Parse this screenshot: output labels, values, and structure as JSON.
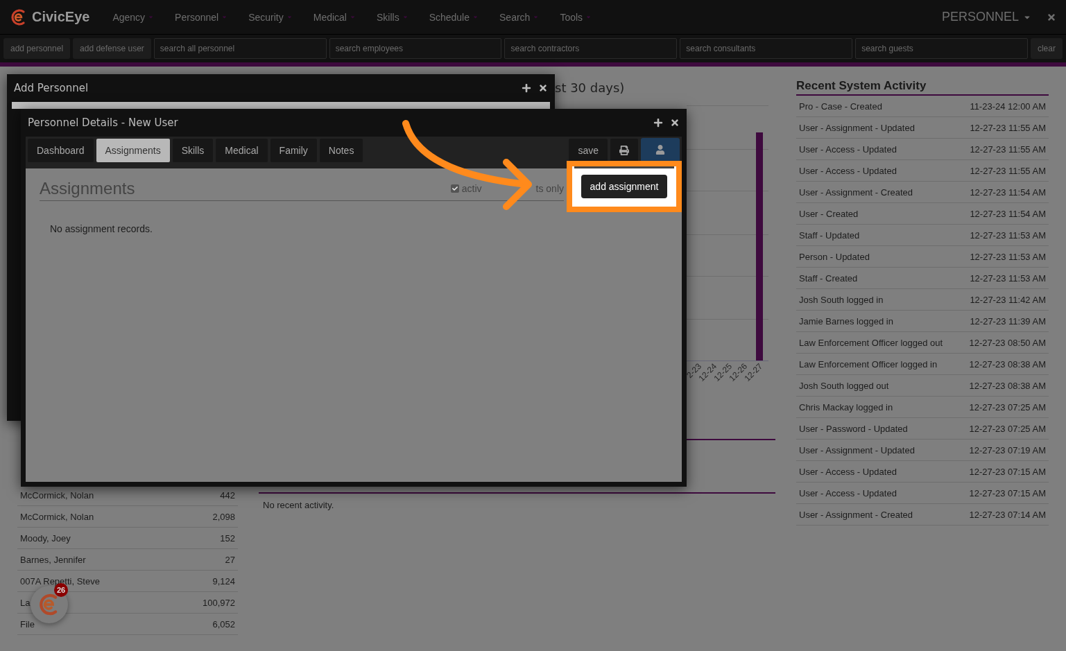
{
  "app": {
    "logo_text": "CivicEye",
    "menu": [
      {
        "label": "Agency"
      },
      {
        "label": "Personnel"
      },
      {
        "label": "Security"
      },
      {
        "label": "Medical"
      },
      {
        "label": "Skills"
      },
      {
        "label": "Schedule"
      },
      {
        "label": "Search"
      },
      {
        "label": "Tools"
      }
    ],
    "section": "PERSONNEL"
  },
  "toolbar": {
    "buttons": [
      "add personnel",
      "add defense user"
    ],
    "searches": [
      {
        "placeholder": "search all personnel"
      },
      {
        "placeholder": "search employees"
      },
      {
        "placeholder": "search contractors"
      },
      {
        "placeholder": "search consultants"
      },
      {
        "placeholder": "search guests"
      }
    ],
    "clear": "clear"
  },
  "background": {
    "chart_title": "st 30 days)",
    "x_labels": [
      "2-23",
      "12-24",
      "12-25",
      "12-26",
      "12-27"
    ],
    "activity_note": "No recent activity.",
    "people": [
      {
        "name": "McCormick, Nolan",
        "count": "442"
      },
      {
        "name": "McCormick, Nolan",
        "count": "2,098"
      },
      {
        "name": "Moody, Joey",
        "count": "152"
      },
      {
        "name": "Barnes, Jennifer",
        "count": "27"
      },
      {
        "name": "007A Repetti, Steve",
        "count": "9,124"
      },
      {
        "name": "La",
        "count": "100,972"
      },
      {
        "name": "File",
        "count": "6,052"
      }
    ],
    "recent": {
      "title": "Recent System Activity",
      "items": [
        {
          "event": "Pro - Case - Created",
          "time": "11-23-24 12:00 AM"
        },
        {
          "event": "User - Assignment - Updated",
          "time": "12-27-23 11:55 AM"
        },
        {
          "event": "User - Access - Updated",
          "time": "12-27-23 11:55 AM"
        },
        {
          "event": "User - Access - Updated",
          "time": "12-27-23 11:55 AM"
        },
        {
          "event": "User - Assignment - Created",
          "time": "12-27-23 11:54 AM"
        },
        {
          "event": "User - Created",
          "time": "12-27-23 11:54 AM"
        },
        {
          "event": "Staff - Updated",
          "time": "12-27-23 11:53 AM"
        },
        {
          "event": "Person - Updated",
          "time": "12-27-23 11:53 AM"
        },
        {
          "event": "Staff - Created",
          "time": "12-27-23 11:53 AM"
        },
        {
          "event": "Josh South logged in",
          "time": "12-27-23 11:42 AM"
        },
        {
          "event": "Jamie Barnes logged in",
          "time": "12-27-23 11:39 AM"
        },
        {
          "event": "Law Enforcement Officer logged out",
          "time": "12-27-23 08:50 AM"
        },
        {
          "event": "Law Enforcement Officer logged in",
          "time": "12-27-23 08:38 AM"
        },
        {
          "event": "Josh South logged out",
          "time": "12-27-23 08:38 AM"
        },
        {
          "event": "Chris Mackay logged in",
          "time": "12-27-23 07:25 AM"
        },
        {
          "event": "User - Password - Updated",
          "time": "12-27-23 07:25 AM"
        },
        {
          "event": "User - Assignment - Updated",
          "time": "12-27-23 07:19 AM"
        },
        {
          "event": "User - Access - Updated",
          "time": "12-27-23 07:15 AM"
        },
        {
          "event": "User - Access - Updated",
          "time": "12-27-23 07:15 AM"
        },
        {
          "event": "User - Assignment - Created",
          "time": "12-27-23 07:14 AM"
        }
      ]
    }
  },
  "add_window": {
    "title": "Add Personnel"
  },
  "details_window": {
    "title": "Personnel Details - New User",
    "tabs": [
      {
        "label": "Dashboard",
        "selected": false
      },
      {
        "label": "Assignments",
        "selected": true
      },
      {
        "label": "Skills",
        "selected": false
      },
      {
        "label": "Medical",
        "selected": false
      },
      {
        "label": "Family",
        "selected": false
      },
      {
        "label": "Notes",
        "selected": false
      }
    ],
    "save": "save",
    "heading": "Assignments",
    "active_only": {
      "checked": true,
      "label_parts": [
        "activ",
        "ts only"
      ]
    },
    "add_button": "add assignment",
    "empty": "No assignment records."
  },
  "notifications": {
    "count": "26"
  }
}
